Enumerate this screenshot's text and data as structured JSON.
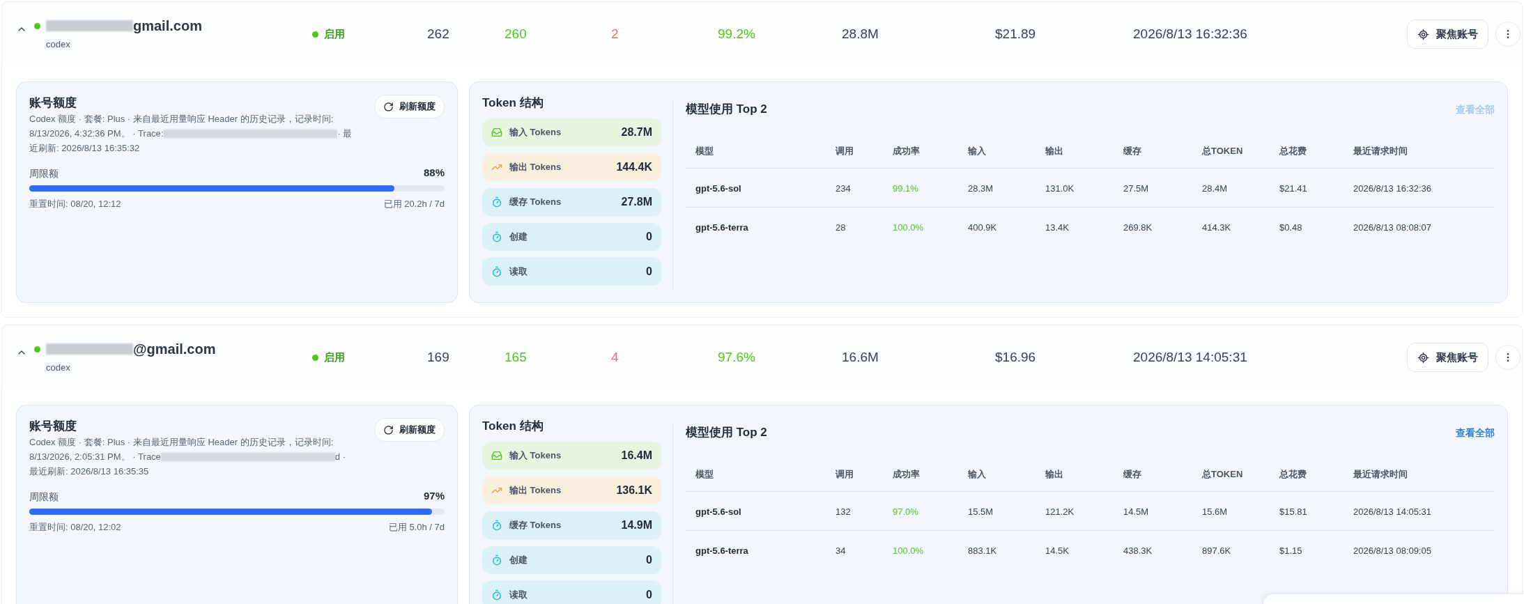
{
  "accounts": [
    {
      "expanded": true,
      "email_suffix": "gmail.com",
      "provider": "codex",
      "status": "启用",
      "metrics": {
        "requests": "262",
        "success": "260",
        "failed": "2",
        "success_rate": "99.2%",
        "tokens": "28.8M",
        "cost": "$21.89",
        "last_request": "2026/8/13 16:32:36"
      },
      "focus_button": "聚焦账号",
      "quota": {
        "title": "账号额度",
        "refresh_button": "刷新额度",
        "description": "Codex 额度 · 套餐: Plus · 来自最近用量响应 Header 的历史记录，记录时间:",
        "trace_prefix": "8/13/2026, 4:32:36 PM。 · Trace:",
        "trace_suffix": "· 最",
        "refresh_line": "近刷新: 2026/8/13 16:35:32",
        "limit_label": "周限额",
        "limit_percent": "88%",
        "level": 0.88,
        "reset_time": "重置时间: 08/20, 12:12",
        "used": "已用 20.2h / 7d"
      },
      "token_title": "Token 结构",
      "tokens": [
        {
          "kind": "input",
          "label": "输入 Tokens",
          "value": "28.7M"
        },
        {
          "kind": "output",
          "label": "输出 Tokens",
          "value": "144.4K"
        },
        {
          "kind": "cache",
          "label": "缓存 Tokens",
          "value": "27.8M"
        },
        {
          "kind": "cache",
          "label": "创建",
          "value": "0"
        },
        {
          "kind": "cache",
          "label": "读取",
          "value": "0"
        }
      ],
      "models_title": "模型使用 Top 2",
      "view_all": {
        "label": "查看全部",
        "disabled": true
      },
      "columns": [
        "模型",
        "调用",
        "成功率",
        "输入",
        "输出",
        "缓存",
        "总TOKEN",
        "总花费",
        "最近请求时间"
      ],
      "rows": [
        [
          "gpt-5.6-sol",
          "234",
          "99.1%",
          "28.3M",
          "131.0K",
          "27.5M",
          "28.4M",
          "$21.41",
          "2026/8/13 16:32:36"
        ],
        [
          "gpt-5.6-terra",
          "28",
          "100.0%",
          "400.9K",
          "13.4K",
          "269.8K",
          "414.3K",
          "$0.48",
          "2026/8/13 08:08:07"
        ]
      ]
    },
    {
      "expanded": true,
      "email_suffix": "@gmail.com",
      "provider": "codex",
      "status": "启用",
      "metrics": {
        "requests": "169",
        "success": "165",
        "failed": "4",
        "success_rate": "97.6%",
        "tokens": "16.6M",
        "cost": "$16.96",
        "last_request": "2026/8/13 14:05:31"
      },
      "focus_button": "聚焦账号",
      "quota": {
        "title": "账号额度",
        "refresh_button": "刷新额度",
        "description": "Codex 额度 · 套餐: Plus · 来自最近用量响应 Header 的历史记录，记录时间:",
        "trace_prefix": "8/13/2026, 2:05:31 PM。 · Trace",
        "trace_suffix": "d ·",
        "refresh_line": "最近刷新: 2026/8/13 16:35:35",
        "limit_label": "周限额",
        "limit_percent": "97%",
        "level": 0.97,
        "reset_time": "重置时间: 08/20, 12:02",
        "used": "已用 5.0h / 7d"
      },
      "token_title": "Token 结构",
      "tokens": [
        {
          "kind": "input",
          "label": "输入 Tokens",
          "value": "16.4M"
        },
        {
          "kind": "output",
          "label": "输出 Tokens",
          "value": "136.1K"
        },
        {
          "kind": "cache",
          "label": "缓存 Tokens",
          "value": "14.9M"
        },
        {
          "kind": "cache",
          "label": "创建",
          "value": "0"
        },
        {
          "kind": "cache",
          "label": "读取",
          "value": "0"
        }
      ],
      "models_title": "模型使用 Top 2",
      "view_all": {
        "label": "查看全部",
        "disabled": false
      },
      "columns": [
        "模型",
        "调用",
        "成功率",
        "输入",
        "输出",
        "缓存",
        "总TOKEN",
        "总花费",
        "最近请求时间"
      ],
      "rows": [
        [
          "gpt-5.6-sol",
          "132",
          "97.0%",
          "15.5M",
          "121.2K",
          "14.5M",
          "15.6M",
          "$15.81",
          "2026/8/13 14:05:31"
        ],
        [
          "gpt-5.6-terra",
          "34",
          "100.0%",
          "883.1K",
          "14.5K",
          "438.3K",
          "897.6K",
          "$1.15",
          "2026/8/13 08:09:05"
        ]
      ]
    }
  ]
}
